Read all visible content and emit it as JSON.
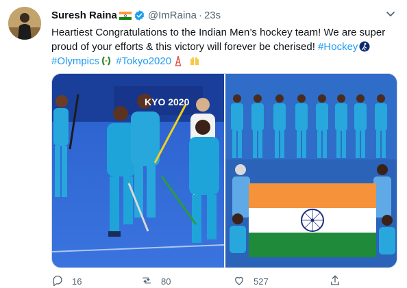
{
  "tweet": {
    "author_name": "Suresh Raina",
    "handle": "@ImRaina",
    "separator": "·",
    "time": "23s",
    "text_intro": "Heartiest Congratulations to the Indian Men’s hockey team! We are super proud of your efforts & this victory will forever be cherised! ",
    "hashtags": [
      "#Hockey",
      "#Olympics",
      "#Tokyo2020"
    ],
    "colors": {
      "link": "#1d9bf0",
      "secondary": "#536471",
      "flag_saffron": "#ff9933",
      "flag_green": "#138808"
    }
  },
  "media": {
    "left_banner_text": "KYO 2020"
  },
  "actions": {
    "reply_count": "16",
    "retweet_count": "80",
    "like_count": "527",
    "icons": [
      "reply-icon",
      "retweet-icon",
      "like-icon",
      "share-icon"
    ]
  }
}
